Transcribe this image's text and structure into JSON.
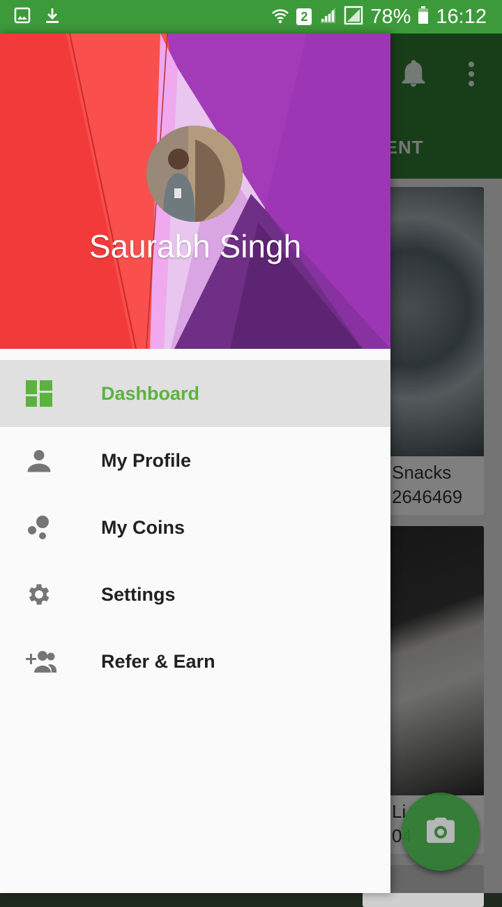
{
  "status_bar": {
    "battery_percent": "78%",
    "time": "16:12",
    "sim_slot": "2",
    "icons": [
      "gallery-icon",
      "download-icon",
      "wifi-icon",
      "signal-icon",
      "signal-icon",
      "battery-icon"
    ]
  },
  "background_app": {
    "tab_label": "MENT",
    "cards": [
      {
        "title": "Snacks",
        "subtitle": "2646469"
      },
      {
        "title": "Li",
        "subtitle": "04"
      }
    ],
    "icons": [
      "bell-icon",
      "more-vert-icon",
      "camera-icon"
    ]
  },
  "drawer": {
    "header": {
      "user_name": "Saurabh Singh"
    },
    "menu": [
      {
        "label": "Dashboard",
        "icon": "dashboard-icon",
        "active": true
      },
      {
        "label": "My Profile",
        "icon": "person-icon",
        "active": false
      },
      {
        "label": "My Coins",
        "icon": "coins-icon",
        "active": false
      },
      {
        "label": "Settings",
        "icon": "gear-icon",
        "active": false
      },
      {
        "label": "Refer & Earn",
        "icon": "group-add-icon",
        "active": false
      }
    ]
  },
  "colors": {
    "status_bar": "#3d9a3a",
    "toolbar": "#2e7d32",
    "accent_active": "#5bb33f",
    "active_row": "#e0e0e0"
  }
}
